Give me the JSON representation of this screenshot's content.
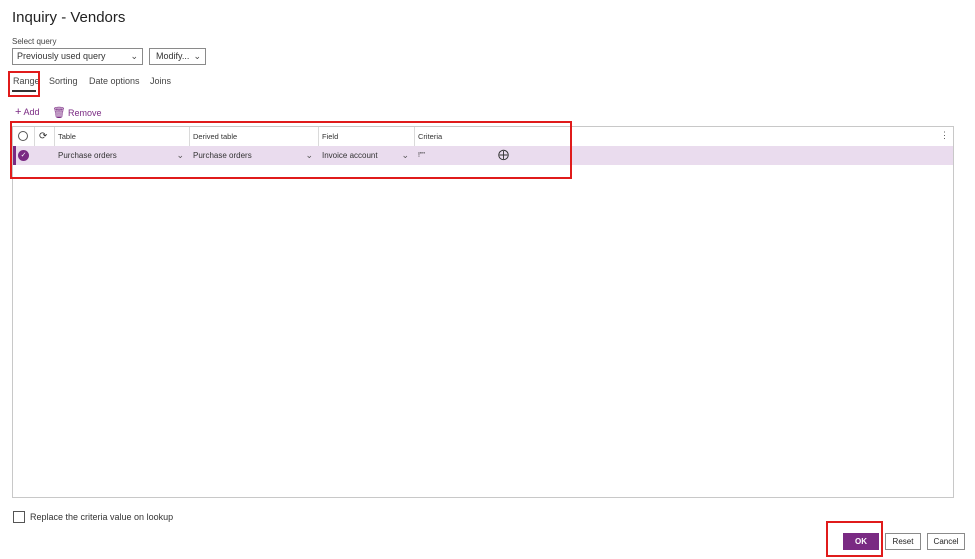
{
  "header": {
    "title": "Inquiry - Vendors"
  },
  "query": {
    "label": "Select query",
    "selected": "Previously used query",
    "modify_label": "Modify..."
  },
  "tabs": [
    {
      "label": "Range",
      "active": true
    },
    {
      "label": "Sorting",
      "active": false
    },
    {
      "label": "Date options",
      "active": false
    },
    {
      "label": "Joins",
      "active": false
    }
  ],
  "actions": {
    "add_label": "Add",
    "remove_label": "Remove"
  },
  "grid": {
    "columns": [
      "Table",
      "Derived table",
      "Field",
      "Criteria"
    ],
    "rows": [
      {
        "table": "Purchase orders",
        "derived_table": "Purchase orders",
        "field": "Invoice account",
        "criteria": "!\"\""
      }
    ]
  },
  "options": {
    "replace_criteria_label": "Replace the criteria value on lookup"
  },
  "buttons": {
    "ok": "OK",
    "reset": "Reset",
    "cancel": "Cancel"
  },
  "colors": {
    "accent": "#7a2a83",
    "selected_row": "#eadcee",
    "highlight": "#e01b1b"
  }
}
